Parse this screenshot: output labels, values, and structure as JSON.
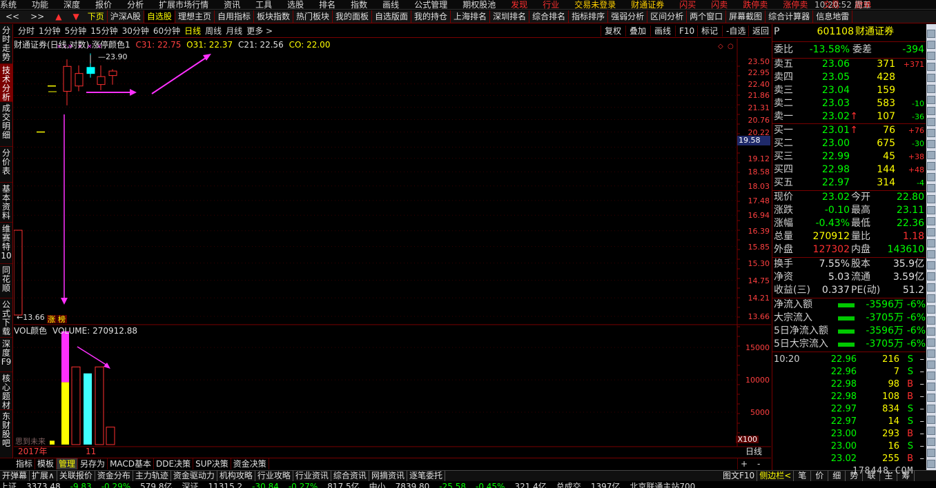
{
  "menu": {
    "items": [
      "系统",
      "功能",
      "深度",
      "报价",
      "分析",
      "扩展市场行情",
      "资讯",
      "工具",
      "选股",
      "排名",
      "指数",
      "画线",
      "公式管理",
      "期权股池",
      "发现",
      "行业",
      "交易未登录",
      "财通证券",
      "闪买",
      "闪卖",
      "跌停卖",
      "涨停卖",
      "交易",
      "撤单"
    ],
    "time": "10:20:52 周五"
  },
  "tabbar": {
    "nav": [
      "<<",
      ">>",
      "▲",
      "▼"
    ],
    "tabs": [
      "下页",
      "沪深A股",
      "自选股",
      "理想主页",
      "自用指标",
      "板块指数",
      "热门板块",
      "我的面板",
      "自选版面",
      "我的持仓",
      "上海排名",
      "深圳排名",
      "综合排名",
      "指标排序",
      "强弱分析",
      "区间分析",
      "两个窗口",
      "屏幕截图",
      "综合计算器",
      "信息地雷"
    ]
  },
  "left_tabs": [
    "分时走势",
    "技术分析",
    "成交明细",
    "分价表",
    "基本资料",
    "维赛特10",
    "同花顺",
    "公式下载",
    "深度F9",
    "核心题材",
    "东财股吧"
  ],
  "periods": [
    "分时",
    "1分钟",
    "5分钟",
    "15分钟",
    "30分钟",
    "60分钟",
    "日线",
    "周线",
    "月线",
    "更多 >"
  ],
  "tool_right": [
    "复权",
    "叠加",
    "画线",
    "F10",
    "标记",
    "-自选",
    "返回"
  ],
  "kinfo": {
    "name": "财通证券(日线,对数)",
    "indicator": "涨停颜色1",
    "c31": "C31: 22.75",
    "o31": "O31: 22.37",
    "c21": "C21: 22.56",
    "co": "CO: 22.00"
  },
  "chart_annot": {
    "high_label": "23.90",
    "low_label": "13.66",
    "tag1": "涨",
    "tag2": "榜"
  },
  "vinfo": {
    "name": "VOL颜色",
    "volume": "VOLUME: 270912.88"
  },
  "price_axis": [
    "23.50",
    "22.95",
    "22.40",
    "21.86",
    "21.31",
    "20.76",
    "20.22",
    "19.58",
    "19.12",
    "18.58",
    "18.03",
    "17.48",
    "16.94",
    "16.39",
    "15.85",
    "15.30",
    "14.75",
    "14.21",
    "13.66"
  ],
  "cur_price_label": "19.58",
  "vol_axis": [
    "15000",
    "10000",
    "5000"
  ],
  "vol_unit": "X100",
  "date_year": "2017年",
  "date_mark": "11",
  "date_right": "日线",
  "pm": [
    "+",
    "-"
  ],
  "bottom_tabs": [
    "指标",
    "模板",
    "管理",
    "另存为",
    "MACD基本",
    "DDE决策",
    "SUP决策",
    "资金决策"
  ],
  "bottom_bar": [
    "开弹幕",
    "扩展∧",
    "关联报价",
    "资金分布",
    "主力轨迹",
    "资金驱动力",
    "机构攻略",
    "行业攻略",
    "行业资讯",
    "综合资讯",
    "网摘资讯",
    "逐笔委托"
  ],
  "bottom_bar_right": [
    "图文F10",
    "侧边栏<",
    "笔",
    "价",
    "细",
    "势",
    "联",
    "主",
    "筹"
  ],
  "watermark": "178448.COM",
  "status": [
    "上证",
    "3373.48",
    "-9.83",
    "-0.29%",
    "579.8亿",
    "深证",
    "11315.2",
    "-30.84",
    "-0.27%",
    "817.5亿",
    "中小",
    "7839.80",
    "-25.58",
    "-0.45%",
    "321.4亿",
    "总成交",
    "1397亿",
    "北京联通主站700"
  ],
  "chart_data": {
    "type": "candlestick",
    "title": "财通证券(日线,对数)",
    "candles": [
      {
        "o": 18.5,
        "h": 18.5,
        "l": 18.5,
        "c": 18.5
      },
      {
        "o": 20.22,
        "h": 20.22,
        "l": 20.22,
        "c": 20.22
      },
      {
        "o": 22.3,
        "h": 22.3,
        "l": 22.3,
        "c": 22.3
      },
      {
        "o": 22.05,
        "h": 23.6,
        "l": 21.4,
        "c": 23.25
      },
      {
        "o": 22.3,
        "h": 23.3,
        "l": 22.05,
        "c": 22.9
      },
      {
        "o": 22.9,
        "h": 23.9,
        "l": 22.7,
        "c": 23.2
      },
      {
        "o": 22.37,
        "h": 23.3,
        "l": 22.1,
        "c": 22.75
      },
      {
        "o": 22.8,
        "h": 23.11,
        "l": 22.36,
        "c": 23.02
      }
    ],
    "volume": [
      {
        "v": 600,
        "color": "yellow"
      },
      {
        "v": 17500,
        "color": "magenta-yellow"
      },
      {
        "v": 12000,
        "color": "red"
      },
      {
        "v": 11000,
        "color": "cyan"
      },
      {
        "v": 12000,
        "color": "red"
      },
      {
        "v": 2700,
        "color": "red"
      }
    ],
    "ylim": [
      13.66,
      23.5
    ],
    "vol_ylim": [
      0,
      18000
    ],
    "scale": "log"
  },
  "quote": {
    "market": "P",
    "code": "601108",
    "name": "财通证券",
    "weibi_l": "委比",
    "weibi": "-13.58%",
    "weicha_l": "委差",
    "weicha": "-394",
    "sells": [
      {
        "l": "卖五",
        "p": "23.06",
        "v": "371",
        "d": "+371",
        "pc": "g",
        "dc": "r",
        "arrow": ""
      },
      {
        "l": "卖四",
        "p": "23.05",
        "v": "428",
        "d": "",
        "pc": "g",
        "dc": "g",
        "arrow": ""
      },
      {
        "l": "卖三",
        "p": "23.04",
        "v": "159",
        "d": "",
        "pc": "g",
        "dc": "g",
        "arrow": ""
      },
      {
        "l": "卖二",
        "p": "23.03",
        "v": "583",
        "d": "-10",
        "pc": "g",
        "dc": "g",
        "arrow": ""
      },
      {
        "l": "卖一",
        "p": "23.02",
        "v": "107",
        "d": "-36",
        "pc": "g",
        "dc": "g",
        "arrow": "↑"
      }
    ],
    "buys": [
      {
        "l": "买一",
        "p": "23.01",
        "v": "76",
        "d": "+76",
        "pc": "g",
        "dc": "r",
        "arrow": "↑"
      },
      {
        "l": "买二",
        "p": "23.00",
        "v": "675",
        "d": "-30",
        "pc": "g",
        "dc": "g",
        "arrow": ""
      },
      {
        "l": "买三",
        "p": "22.99",
        "v": "45",
        "d": "+38",
        "pc": "g",
        "dc": "r",
        "arrow": ""
      },
      {
        "l": "买四",
        "p": "22.98",
        "v": "144",
        "d": "+48",
        "pc": "g",
        "dc": "r",
        "arrow": ""
      },
      {
        "l": "买五",
        "p": "22.97",
        "v": "314",
        "d": "-4",
        "pc": "g",
        "dc": "g",
        "arrow": ""
      }
    ],
    "stats": [
      {
        "l1": "现价",
        "v1": "23.02",
        "c1": "g",
        "l2": "今开",
        "v2": "22.80",
        "c2": "g"
      },
      {
        "l1": "涨跌",
        "v1": "-0.10",
        "c1": "g",
        "l2": "最高",
        "v2": "23.11",
        "c2": "g"
      },
      {
        "l1": "涨幅",
        "v1": "-0.43%",
        "c1": "g",
        "l2": "最低",
        "v2": "22.36",
        "c2": "g"
      },
      {
        "l1": "总量",
        "v1": "270912",
        "c1": "y",
        "l2": "量比",
        "v2": "1.18",
        "c2": "r"
      },
      {
        "l1": "外盘",
        "v1": "127302",
        "c1": "r",
        "l2": "内盘",
        "v2": "143610",
        "c2": "g"
      }
    ],
    "stats2": [
      {
        "l1": "换手",
        "v1": "7.55%",
        "c1": "w",
        "l2": "股本",
        "v2": "35.9亿",
        "c2": "w"
      },
      {
        "l1": "净资",
        "v1": "5.03",
        "c1": "w",
        "l2": "流通",
        "v2": "3.59亿",
        "c2": "w"
      },
      {
        "l1": "收益(三)",
        "v1": "0.337",
        "c1": "w",
        "l2": "PE(动)",
        "v2": "51.2",
        "c2": "w"
      }
    ],
    "flows": [
      {
        "l": "净流入额",
        "v": "-3596万",
        "p": "-6%"
      },
      {
        "l": "大宗流入",
        "v": "-3705万",
        "p": "-6%"
      },
      {
        "l": "5日净流入额",
        "v": "-3596万",
        "p": "-6%"
      },
      {
        "l": "5日大宗流入",
        "v": "-3705万",
        "p": "-6%"
      }
    ],
    "ticks": [
      {
        "t": "10:20",
        "p": "22.96",
        "v": "216",
        "s": "S"
      },
      {
        "t": "",
        "p": "22.96",
        "v": "7",
        "s": "S"
      },
      {
        "t": "",
        "p": "22.98",
        "v": "98",
        "s": "B"
      },
      {
        "t": "",
        "p": "22.98",
        "v": "108",
        "s": "B"
      },
      {
        "t": "",
        "p": "22.97",
        "v": "834",
        "s": "S"
      },
      {
        "t": "",
        "p": "22.97",
        "v": "14",
        "s": "S"
      },
      {
        "t": "",
        "p": "23.00",
        "v": "293",
        "s": "B"
      },
      {
        "t": "",
        "p": "23.00",
        "v": "16",
        "s": "S"
      },
      {
        "t": "",
        "p": "23.02",
        "v": "255",
        "s": "B"
      }
    ]
  }
}
